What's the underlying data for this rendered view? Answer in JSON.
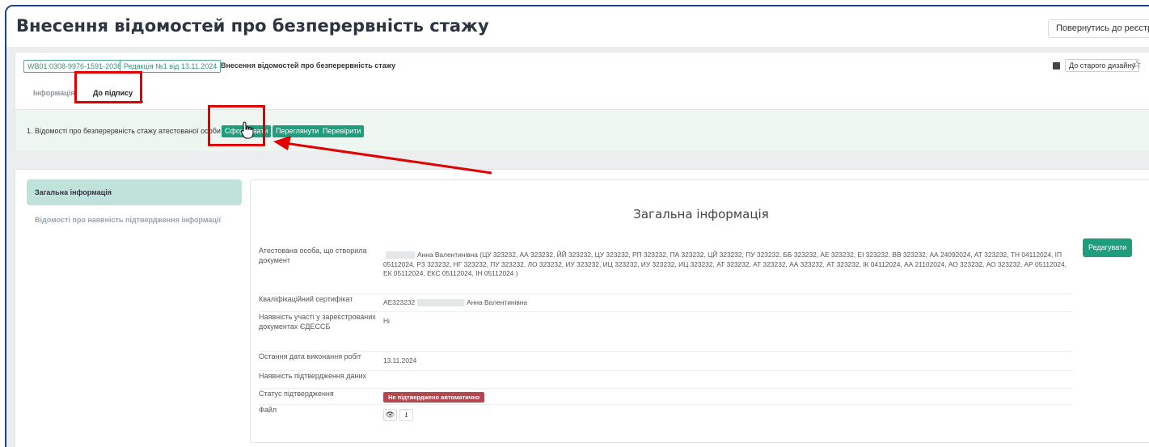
{
  "page_title": "Внесення відомостей про безперервність стажу",
  "header": {
    "back_button": "Повернутись до реєстру"
  },
  "document": {
    "badge_number": "WB01:0308-9976-1591-2036",
    "badge_revision": "Редакція №1 від 13.11.2024",
    "doc_title": "Внесення відомостей про безперервність стажу",
    "old_design_button": "До старого дизайну",
    "icons": {
      "old_design": "square-icon",
      "favorite": "star-icon"
    }
  },
  "tabs": [
    {
      "label": "Інформація",
      "active": false
    },
    {
      "label": "До підпису",
      "active": true
    }
  ],
  "step": {
    "text": "1. Відомості про безперервність стажу атестованої особи",
    "buttons": {
      "form": "Сформувати",
      "review": "Переглянути",
      "check": "Перевірити"
    }
  },
  "sidebar": {
    "items": [
      {
        "label": "Загальна інформація",
        "active": true
      },
      {
        "label": "Відомості про наявність підтвердження інформації",
        "active": false
      }
    ]
  },
  "info": {
    "title": "Загальна інформація",
    "edit_button": "Редагувати",
    "rows": [
      {
        "label": "Атестована особа, що створила документ",
        "value": "Анна Валентинівна (ЦУ 323232, АА 323232, ЙЙ 323232, ЦУ 323232, РП 323232, ПА 323232, ЦЙ 323232, ПУ 323232, ББ 323232, АЕ 323232, ЕІ 323232, ВВ 323232, АА 24092024, АТ 323232, ТН 04112024, ІП 05112024, РЗ 323232, НГ 323232, ПУ 323232, ЛО 323232, ИУ 323232, ИЦ 323232, ИУ 323232, ИЦ 323232, АТ 323232, АТ 323232, АА 323232, АТ 323232, ІК 04112024, АА 21102024, АО 323232, АО 323232, АР 05112024, ЕК 05112024, ЕКС 05112024, ІН 05112024 )"
      },
      {
        "label": "Кваліфікаційний сертифікат",
        "value_prefix": "АЕ323232",
        "value_suffix": "Анна Валентинівна"
      },
      {
        "label": "Наявність участі у зареєстрованих документах ЄДЕССБ",
        "value": "Ні"
      },
      {
        "label": "Остання дата виконання робіт",
        "value": "13.11.2024"
      },
      {
        "label": "Наявність підтвердження даних",
        "value": ""
      },
      {
        "label": "Статус підтвердження",
        "value": "Не підтверджено автоматично"
      },
      {
        "label": "Файл",
        "icons": [
          "eye-icon",
          "download-icon"
        ],
        "glyphs": [
          "👁",
          "⭳"
        ]
      }
    ]
  },
  "colors": {
    "accent_green": "#1e9e7c",
    "highlight_red": "#e00000",
    "status_red": "#b4474f",
    "frame_blue": "#1d3f8f"
  }
}
